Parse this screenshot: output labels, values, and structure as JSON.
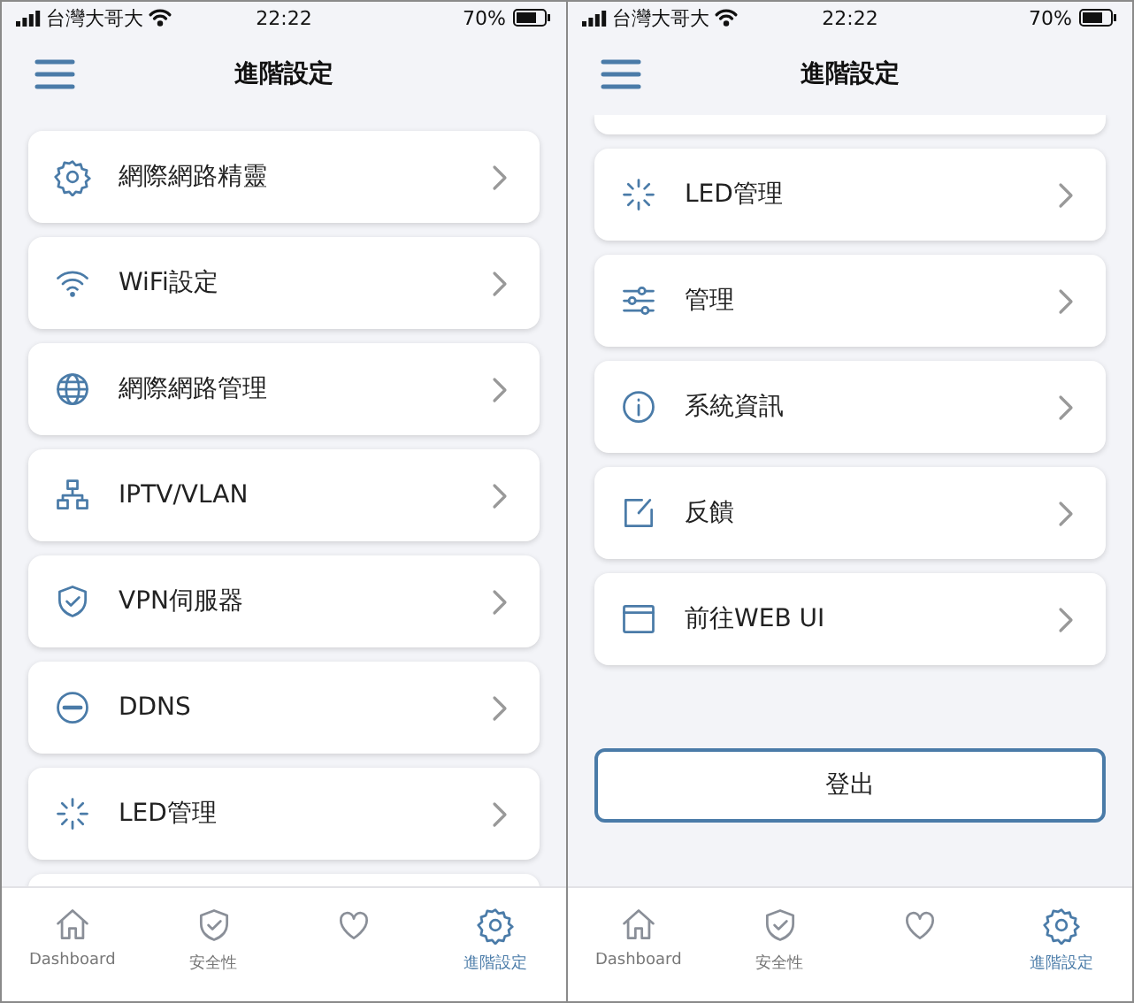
{
  "screens": [
    {
      "status_bar": {
        "carrier": "台灣大哥大",
        "time": "22:22",
        "battery": "70%"
      },
      "title": "進階設定",
      "items": [
        {
          "kind": "gear",
          "label": "網際網路精靈"
        },
        {
          "kind": "wifi",
          "label": "WiFi設定"
        },
        {
          "kind": "globe",
          "label": "網際網路管理"
        },
        {
          "kind": "network",
          "label": "IPTV/VLAN"
        },
        {
          "kind": "shield",
          "label": "VPN伺服器"
        },
        {
          "kind": "ddns",
          "label": "DDNS"
        },
        {
          "kind": "led",
          "label": "LED管理"
        },
        {
          "kind": "partial_bottom"
        }
      ],
      "tabs": [
        {
          "kind": "home",
          "label": "Dashboard",
          "selected": false
        },
        {
          "kind": "shield",
          "label": "安全性",
          "selected": false
        },
        {
          "kind": "heart",
          "selected": false
        },
        {
          "kind": "gear",
          "label": "進階設定",
          "selected": true
        }
      ]
    },
    {
      "status_bar": {
        "carrier": "台灣大哥大",
        "time": "22:22",
        "battery": "70%"
      },
      "title": "進階設定",
      "items": [
        {
          "kind": "partial_top"
        },
        {
          "kind": "led",
          "label": "LED管理"
        },
        {
          "kind": "sliders",
          "label": "管理"
        },
        {
          "kind": "info",
          "label": "系統資訊"
        },
        {
          "kind": "edit",
          "label": "反饋"
        },
        {
          "kind": "window",
          "label": "前往WEB UI"
        }
      ],
      "logout": "登出",
      "tabs": [
        {
          "kind": "home",
          "label": "Dashboard",
          "selected": false
        },
        {
          "kind": "shield",
          "label": "安全性",
          "selected": false
        },
        {
          "kind": "heart",
          "selected": false
        },
        {
          "kind": "gear",
          "label": "進階設定",
          "selected": true
        }
      ]
    }
  ]
}
